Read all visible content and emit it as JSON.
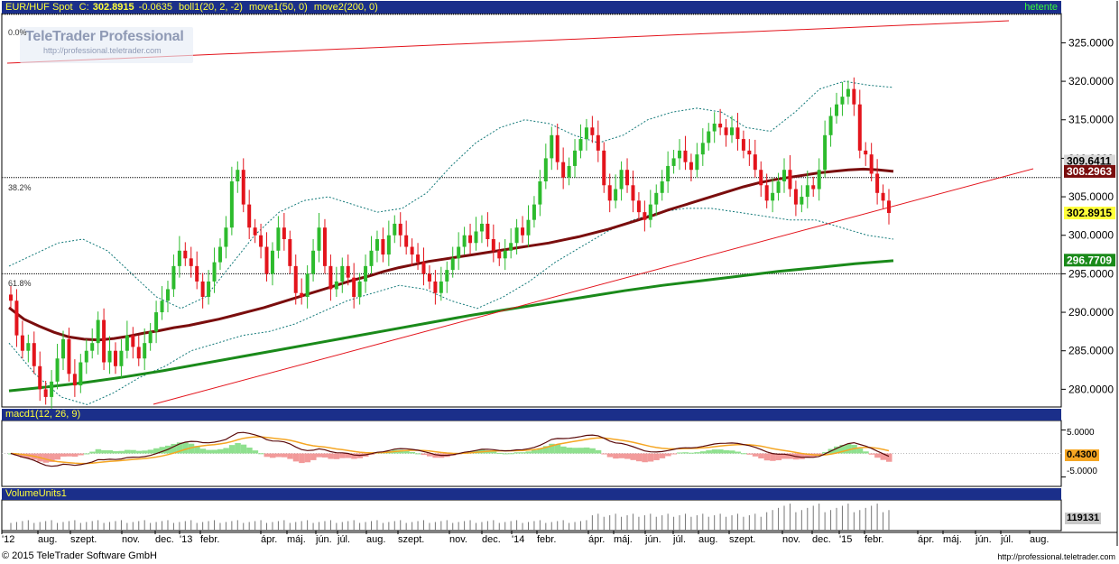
{
  "header": {
    "instrument": "EUR/HUF Spot",
    "close_label": "C:",
    "close": "302.8915",
    "change": "-0.0635",
    "indicators": [
      "boll1(20, 2, -2)",
      "move1(50, 0)",
      "move2(200, 0)"
    ],
    "period": "hetente"
  },
  "brand": {
    "title": "TeleTrader Professional",
    "url": "http://professional.teletrader.com"
  },
  "fib_labels": [
    "0.0%",
    "38.2%",
    "61.8%"
  ],
  "macd_panel": {
    "title": "macd1(12, 26, 9)",
    "ticks": [
      "5.0000",
      "-5.0000"
    ],
    "value_box": "0.4300"
  },
  "volume_panel": {
    "title": "VolumeUnits1",
    "value_box": "119131"
  },
  "x_axis_labels": [
    "'12",
    "aug.",
    "szept.",
    "nov.",
    "dec.",
    "'13",
    "febr.",
    "ápr.",
    "máj.",
    "jún.",
    "júl.",
    "aug.",
    "szept.",
    "nov.",
    "dec.",
    "'14",
    "febr.",
    "ápr.",
    "máj.",
    "jún.",
    "júl.",
    "aug.",
    "szept.",
    "nov.",
    "dec.",
    "'15",
    "febr.",
    "ápr.",
    "máj.",
    "jún.",
    "júl.",
    "aug."
  ],
  "footer": {
    "copyright": "© 2015 TeleTrader Software GmbH",
    "url": "http://professional.teletrader.com"
  },
  "colors": {
    "up": "#2dbb2d",
    "down": "#e3141c",
    "ma50": "#7a0d0d",
    "ma200": "#1a8a1a",
    "boll_band": "#147a7a",
    "trend": "#e3141c",
    "panel_bar": "#1b2f8a"
  },
  "chart_data": {
    "type": "candlestick",
    "title": "EUR/HUF Spot",
    "y_ticks": [
      "325.0000",
      "320.0000",
      "315.0000",
      "310.0000",
      "305.0000",
      "300.0000",
      "295.0000",
      "290.0000",
      "285.0000",
      "280.0000"
    ],
    "ylim": [
      277.7,
      328.8
    ],
    "price_labels": {
      "last": "302.8915",
      "ma50": "308.2963",
      "ma200": "296.7709",
      "upper_band": "309.6411"
    },
    "fib_levels": [
      {
        "label": "0.0%",
        "value": 328.7
      },
      {
        "label": "38.2%",
        "value": 307.5
      },
      {
        "label": "61.8%",
        "value": 295.0
      }
    ],
    "close": [
      291.5,
      287.0,
      285.0,
      286.0,
      283.0,
      280.0,
      279.0,
      281.0,
      284.0,
      286.5,
      282.0,
      280.5,
      283.5,
      285.0,
      286.0,
      289.0,
      283.5,
      285.0,
      283.0,
      285.0,
      287.0,
      285.5,
      284.0,
      286.0,
      287.5,
      290.0,
      291.5,
      293.0,
      296.0,
      298.0,
      297.0,
      296.0,
      294.0,
      292.0,
      294.0,
      296.5,
      298.5,
      301.0,
      307.0,
      308.5,
      304.0,
      301.0,
      300.0,
      298.5,
      295.0,
      298.0,
      301.0,
      299.5,
      296.0,
      292.5,
      292.0,
      295.0,
      298.0,
      301.0,
      296.0,
      293.0,
      294.0,
      296.0,
      294.5,
      292.0,
      294.0,
      296.0,
      298.0,
      299.5,
      297.5,
      300.0,
      301.5,
      300.0,
      298.5,
      297.5,
      296.5,
      295.0,
      294.0,
      292.5,
      294.0,
      295.5,
      297.0,
      298.5,
      300.0,
      299.0,
      300.5,
      301.5,
      299.5,
      298.0,
      297.0,
      298.0,
      299.0,
      301.0,
      300.0,
      302.0,
      304.0,
      307.0,
      310.0,
      313.0,
      309.5,
      307.5,
      309.0,
      311.0,
      312.5,
      314.0,
      313.0,
      311.0,
      306.5,
      304.5,
      306.0,
      308.5,
      306.5,
      304.5,
      303.0,
      302.0,
      304.0,
      305.5,
      307.0,
      309.0,
      310.0,
      311.0,
      309.5,
      308.5,
      310.5,
      312.0,
      313.5,
      314.5,
      314.0,
      313.0,
      314.0,
      312.5,
      311.0,
      310.5,
      308.5,
      306.5,
      304.5,
      305.5,
      307.0,
      308.5,
      306.0,
      304.0,
      305.0,
      306.5,
      306.0,
      308.5,
      313.0,
      315.5,
      317.0,
      318.0,
      319.0,
      317.0,
      311.0,
      310.5,
      308.0,
      305.5,
      304.5,
      302.9
    ],
    "ma50": [
      290.6,
      289.1,
      288.2,
      287.4,
      286.8,
      286.5,
      286.4,
      286.6,
      286.9,
      287.3,
      287.6,
      288.0,
      288.3,
      288.7,
      289.1,
      289.6,
      290.1,
      290.6,
      291.2,
      291.8,
      292.4,
      293.0,
      293.6,
      294.2,
      294.7,
      295.3,
      295.8,
      296.2,
      296.6,
      296.9,
      297.2,
      297.5,
      297.8,
      298.1,
      298.4,
      298.7,
      299.0,
      299.4,
      299.8,
      300.3,
      300.8,
      301.4,
      302.0,
      302.6,
      303.3,
      303.9,
      304.5,
      305.1,
      305.7,
      306.3,
      306.8,
      307.2,
      307.5,
      307.8,
      308.1,
      308.3,
      308.5,
      308.6,
      308.5,
      308.3
    ],
    "ma200": [
      279.8,
      280.3,
      280.9,
      281.6,
      282.4,
      283.3,
      284.2,
      285.1,
      286.0,
      286.9,
      287.8,
      288.7,
      289.6,
      290.4,
      291.2,
      292.0,
      292.8,
      293.5,
      294.1,
      294.7,
      295.3,
      295.8,
      296.3,
      296.7
    ],
    "boll_upper": [
      296.0,
      297.5,
      299.0,
      299.5,
      298.0,
      295.0,
      292.0,
      290.5,
      292.0,
      296.0,
      300.0,
      303.0,
      304.5,
      305.0,
      304.0,
      303.0,
      303.5,
      305.5,
      309.0,
      312.0,
      314.0,
      315.0,
      314.5,
      313.0,
      312.0,
      313.0,
      315.0,
      316.0,
      316.5,
      316.0,
      314.0,
      313.5,
      316.0,
      319.0,
      320.0,
      319.5,
      319.2
    ],
    "boll_lower": [
      286.0,
      282.0,
      279.0,
      278.0,
      279.5,
      281.5,
      283.0,
      285.0,
      286.0,
      287.0,
      287.5,
      288.5,
      290.0,
      291.5,
      292.5,
      293.5,
      293.0,
      291.5,
      290.5,
      292.0,
      294.0,
      296.5,
      298.5,
      300.5,
      302.0,
      303.0,
      303.5,
      303.5,
      303.0,
      302.5,
      302.0,
      302.0,
      301.0,
      300.0,
      299.5
    ],
    "macd": {
      "ylim": [
        -7,
        7
      ],
      "ticks": [
        5,
        -5
      ],
      "last": 0.43
    },
    "volume": {
      "last": 119131
    }
  }
}
